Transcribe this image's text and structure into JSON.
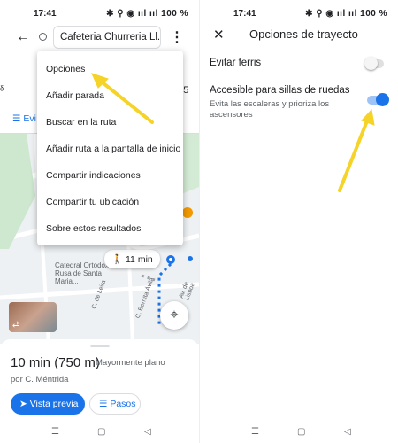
{
  "left_screen": {
    "status": {
      "time": "17:41",
      "indicators": "✱ ⚲ ◉ ııl ııl 100 %"
    },
    "search": {
      "destination": "Cafeteria Churreria Ll..."
    },
    "mode_strip": {
      "left_fragment": "ᵟ",
      "right_fragment": "ᵟ 5"
    },
    "options_fragment": "Evi",
    "menu": {
      "items": [
        "Opciones",
        "Añadir parada",
        "Buscar en la ruta",
        "Añadir ruta a la pantalla de inicio",
        "Compartir indicaciones",
        "Compartir tu ubicación",
        "Sobre estos resultados"
      ]
    },
    "map": {
      "walk_time": "11 min",
      "landmark": "Catedral Ortodoxa Rusa de Santa Maria...",
      "streets": [
        "C. de Leira",
        "C. Berlin",
        "C. Hero",
        "C. Bernita Ávila",
        "Av. de Lisboa"
      ]
    },
    "route": {
      "duration": "10 min (750 m)",
      "note": "Mayormente plano",
      "via": "por C. Méntrida",
      "preview_label": "Vista previa",
      "steps_label": "Pasos"
    }
  },
  "right_screen": {
    "status": {
      "time": "17:41",
      "indicators": "✱ ⚲ ◉ ııl ııl 100 %"
    },
    "title": "Opciones de trayecto",
    "options": [
      {
        "label": "Evitar ferris",
        "enabled": false
      },
      {
        "label": "Accesible para sillas de ruedas",
        "description": "Evita las escaleras y prioriza los ascensores",
        "enabled": true
      }
    ]
  },
  "colors": {
    "accent": "#1a73e8",
    "annotation_arrow": "#f5d327"
  },
  "icons": {
    "back": "arrow-left-icon",
    "more": "more-vert-icon",
    "close": "close-icon",
    "locate": "my-location-icon",
    "walk": "walk-icon",
    "nav": "navigation-icon",
    "steps": "list-icon"
  }
}
